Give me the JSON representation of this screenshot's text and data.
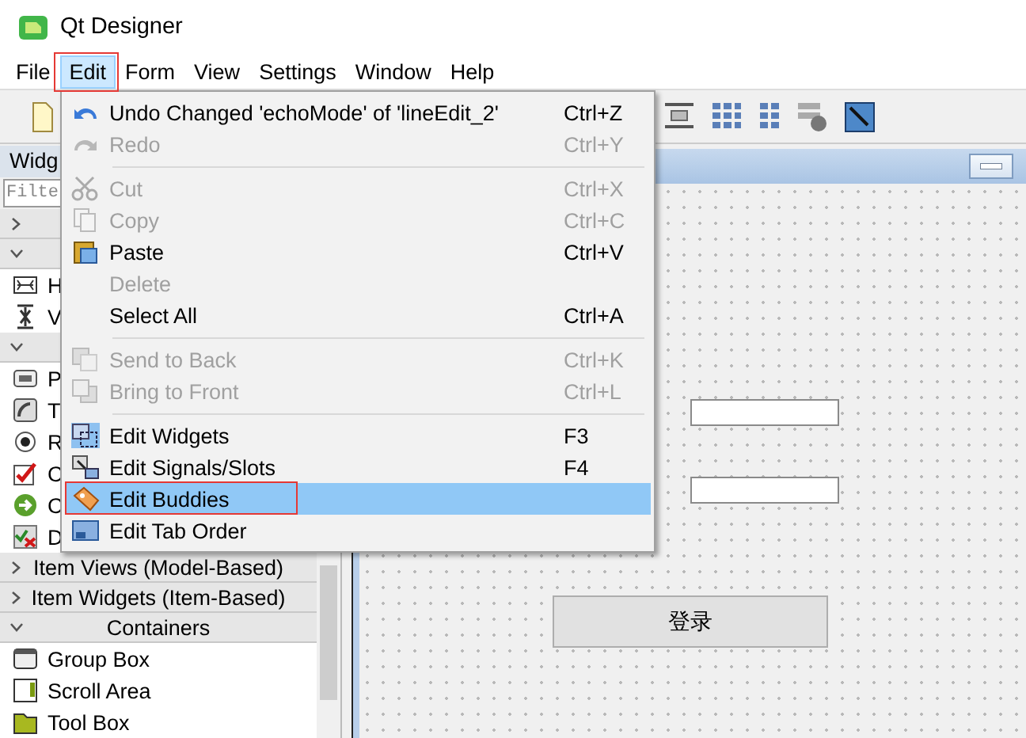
{
  "window": {
    "title": "Qt Designer"
  },
  "menubar": [
    {
      "label": "File",
      "selected": false,
      "annotated": false
    },
    {
      "label": "Edit",
      "selected": true,
      "annotated": true
    },
    {
      "label": "Form",
      "selected": false,
      "annotated": false
    },
    {
      "label": "View",
      "selected": false,
      "annotated": false
    },
    {
      "label": "Settings",
      "selected": false,
      "annotated": false
    },
    {
      "label": "Window",
      "selected": false,
      "annotated": false
    },
    {
      "label": "Help",
      "selected": false,
      "annotated": false
    }
  ],
  "edit_menu": [
    {
      "kind": "item",
      "label": "Undo Changed 'echoMode' of 'lineEdit_2'",
      "shortcut": "Ctrl+Z",
      "disabled": false,
      "checked": false,
      "selected": false,
      "annotated": false
    },
    {
      "kind": "item",
      "label": "Redo",
      "shortcut": "Ctrl+Y",
      "disabled": true,
      "checked": false,
      "selected": false,
      "annotated": false
    },
    {
      "kind": "separator"
    },
    {
      "kind": "item",
      "label": "Cut",
      "shortcut": "Ctrl+X",
      "disabled": true,
      "checked": false,
      "selected": false,
      "annotated": false
    },
    {
      "kind": "item",
      "label": "Copy",
      "shortcut": "Ctrl+C",
      "disabled": true,
      "checked": false,
      "selected": false,
      "annotated": false
    },
    {
      "kind": "item",
      "label": "Paste",
      "shortcut": "Ctrl+V",
      "disabled": false,
      "checked": false,
      "selected": false,
      "annotated": false
    },
    {
      "kind": "item",
      "label": "Delete",
      "disabled": true,
      "checked": false,
      "selected": false,
      "annotated": false
    },
    {
      "kind": "item",
      "label": "Select All",
      "shortcut": "Ctrl+A",
      "disabled": false,
      "checked": false,
      "selected": false,
      "annotated": false
    },
    {
      "kind": "separator"
    },
    {
      "kind": "item",
      "label": "Send to Back",
      "shortcut": "Ctrl+K",
      "disabled": true,
      "checked": false,
      "selected": false,
      "annotated": false
    },
    {
      "kind": "item",
      "label": "Bring to Front",
      "shortcut": "Ctrl+L",
      "disabled": true,
      "checked": false,
      "selected": false,
      "annotated": false
    },
    {
      "kind": "separator"
    },
    {
      "kind": "item",
      "label": "Edit Widgets",
      "shortcut": "F3",
      "disabled": false,
      "checked": true,
      "selected": false,
      "annotated": false
    },
    {
      "kind": "item",
      "label": "Edit Signals/Slots",
      "shortcut": "F4",
      "disabled": false,
      "checked": false,
      "selected": false,
      "annotated": false
    },
    {
      "kind": "item",
      "label": "Edit Buddies",
      "disabled": false,
      "checked": false,
      "selected": true,
      "annotated": true
    },
    {
      "kind": "item",
      "label": "Edit Tab Order",
      "disabled": false,
      "checked": false,
      "selected": false,
      "annotated": false
    }
  ],
  "widget_box": {
    "title": "Widg",
    "filter_placeholder": "Filte",
    "categories": [
      {
        "expanded": false
      },
      {
        "expanded": true,
        "widgets": [
          "H",
          "V"
        ]
      },
      {
        "expanded": true,
        "widgets": [
          "P",
          "T",
          "R",
          "C",
          "C",
          "D"
        ]
      },
      {
        "label": "Item Views (Model-Based)",
        "expanded": false
      },
      {
        "label": "Item Widgets (Item-Based)",
        "expanded": false
      },
      {
        "label": "Containers",
        "expanded": true,
        "widgets": [
          "Group Box",
          "Scroll Area",
          "Tool Box"
        ]
      }
    ]
  },
  "form": {
    "fields": [
      {
        "kind": "line-edit"
      },
      {
        "kind": "line-edit"
      }
    ],
    "button": "登录"
  }
}
